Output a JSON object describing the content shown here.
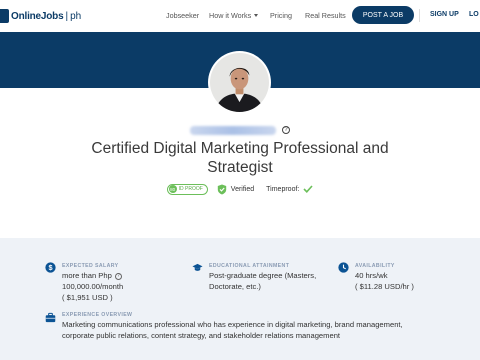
{
  "header": {
    "logo_text": "OnlineJobs",
    "logo_sep": "|",
    "logo_suffix": "ph",
    "nav": {
      "jobseeker": "Jobseeker",
      "how_it_works": "How it Works",
      "pricing": "Pricing",
      "real_results": "Real Results"
    },
    "post_job": "POST A JOB",
    "sign_up": "SIGN UP",
    "login": "LO"
  },
  "colors": {
    "brand_navy": "#0b3b66",
    "panel_bg": "#eef2f7",
    "verified_green": "#6cbf5a",
    "label_gray": "#8a9bb3"
  },
  "profile": {
    "title": "Certified Digital Marketing Professional and Strategist",
    "id_proof_score": "80",
    "id_proof_label": "ID PROOF",
    "verified_label": "Verified",
    "timeproof_label": "Timeproof:"
  },
  "details": {
    "expected_salary": {
      "label": "EXPECTED SALARY",
      "line1": "more than Php",
      "line2": "100,000.00/month",
      "line3": "( $1,951 USD )"
    },
    "education": {
      "label": "EDUCATIONAL ATTAINMENT",
      "line1": "Post-graduate degree (Masters,",
      "line2": "Doctorate, etc.)"
    },
    "availability": {
      "label": "AVAILABILITY",
      "line1": "40 hrs/wk",
      "line2": "( $11.28 USD/hr )"
    },
    "experience": {
      "label": "EXPERIENCE OVERVIEW",
      "line1": "Marketing communications professional who has experience in digital marketing, brand management,",
      "line2": "corporate public relations, content strategy, and stakeholder relations management"
    }
  }
}
